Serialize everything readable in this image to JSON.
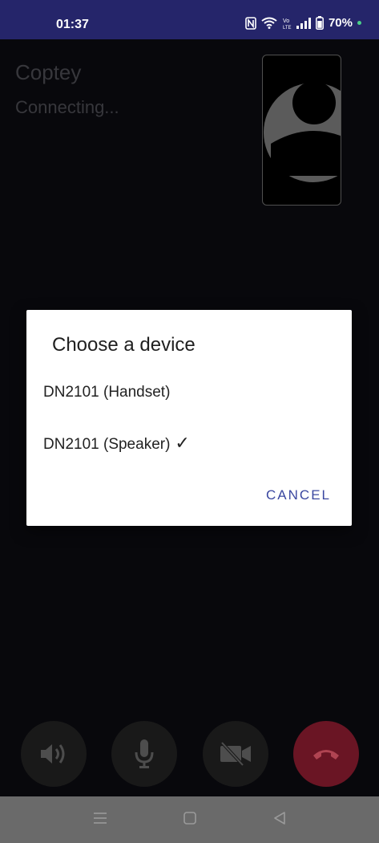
{
  "status_bar": {
    "time": "01:37",
    "icons": [
      "nfc-icon",
      "wifi-icon",
      "volte-icon",
      "signal-icon",
      "battery-icon"
    ],
    "volte_label": "Vo LTE",
    "battery": "70%"
  },
  "call": {
    "caller_name": "Coptey",
    "status": "Connecting..."
  },
  "dialog": {
    "title": "Choose a device",
    "options": [
      {
        "label": "DN2101 (Handset)",
        "selected": false
      },
      {
        "label": "DN2101 (Speaker)",
        "selected": true,
        "check": "✓"
      }
    ],
    "cancel_label": "CANCEL"
  },
  "controls": [
    {
      "icon": "speaker-icon"
    },
    {
      "icon": "microphone-icon"
    },
    {
      "icon": "video-off-icon"
    },
    {
      "icon": "hang-up-icon"
    }
  ],
  "nav_bar": {
    "icons": [
      "menu-icon",
      "home-icon",
      "back-icon"
    ]
  },
  "colors": {
    "status_bar_bg": "#25256a",
    "call_bg": "#0b0b10",
    "hang_up": "#6a1524",
    "accent": "#3a47a0"
  }
}
